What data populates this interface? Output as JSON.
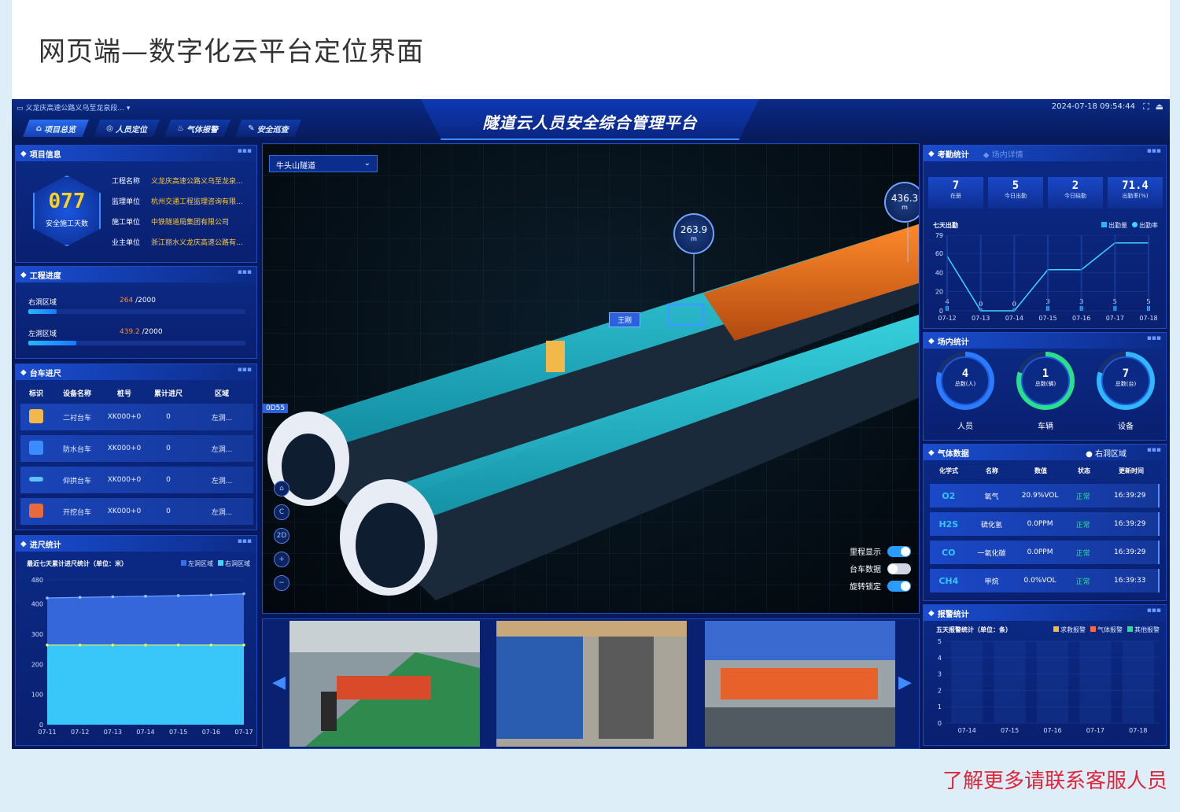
{
  "doc_title": "网页端—数字化云平台定位界面",
  "footer_note": "了解更多请联系客服人员",
  "header": {
    "project_select": "义龙庆高速公路义乌至龙泉段... ▾",
    "platform_title": "隧道云人员安全综合管理平台",
    "datetime": "2024-07-18 09:54:44",
    "nav": [
      {
        "label": "项目总览",
        "icon": "⌂"
      },
      {
        "label": "人员定位",
        "icon": "◎"
      },
      {
        "label": "气体报警",
        "icon": "♨"
      },
      {
        "label": "安全巡查",
        "icon": "✎"
      }
    ]
  },
  "project_info": {
    "title": "项目信息",
    "safe_days": "077",
    "safe_days_label": "安全施工天数",
    "rows": [
      {
        "k": "工程名称",
        "v": "义龙庆高速公路义乌至龙泉..."
      },
      {
        "k": "监理单位",
        "v": "杭州交通工程监理咨询有限..."
      },
      {
        "k": "施工单位",
        "v": "中铁隧道局集团有限公司"
      },
      {
        "k": "业主单位",
        "v": "浙江丽水义龙庆高速公路有..."
      }
    ]
  },
  "progress": {
    "title": "工程进度",
    "items": [
      {
        "label": "右洞区域",
        "value": "264",
        "total": "/2000",
        "fraction": 0.132
      },
      {
        "label": "左洞区域",
        "value": "439.2",
        "total": "/2000",
        "fraction": 0.22
      }
    ]
  },
  "carts": {
    "title": "台车进尺",
    "headers": [
      "标识",
      "设备名称",
      "桩号",
      "累计进尺",
      "区域"
    ],
    "rows": [
      {
        "name": "二衬台车",
        "station": "XK000+0",
        "total": "0",
        "area": "左洞...",
        "color": "#f2b84a"
      },
      {
        "name": "防水台车",
        "station": "XK000+0",
        "total": "0",
        "area": "左洞...",
        "color": "#3b8cff"
      },
      {
        "name": "仰拱台车",
        "station": "XK000+0",
        "total": "0",
        "area": "左洞...",
        "color": "#5fc0ff"
      },
      {
        "name": "开挖台车",
        "station": "XK000+0",
        "total": "0",
        "area": "左洞...",
        "color": "#e86a3a"
      }
    ]
  },
  "advance": {
    "title": "进尺统计",
    "subtitle": "最近七天累计进尺统计（单位：米）",
    "legend": [
      "左洞区域",
      "右洞区域"
    ]
  },
  "scene": {
    "tunnel_name": "牛头山隧道",
    "bubble1": {
      "value": "263.9",
      "unit": "m"
    },
    "bubble2": {
      "value": "436.3",
      "unit": "m"
    },
    "person_tag": "王刚",
    "left_tag": "0D55",
    "controls": [
      "⌂",
      "C",
      "2D",
      "+",
      "−"
    ],
    "toggles": [
      {
        "label": "里程显示",
        "on": true
      },
      {
        "label": "台车数据",
        "on": false
      },
      {
        "label": "旋转锁定",
        "on": true
      }
    ]
  },
  "attendance": {
    "title": "考勤统计",
    "tab2": "场内详情",
    "stats": [
      {
        "n": "7",
        "l": "在册"
      },
      {
        "n": "5",
        "l": "今日出勤"
      },
      {
        "n": "2",
        "l": "今日缺勤"
      },
      {
        "n": "71.4",
        "l": "出勤率(%)"
      }
    ],
    "chart_label": "七天出勤",
    "legend": [
      "出勤量",
      "出勤率"
    ]
  },
  "site_stats": {
    "title": "场内统计",
    "rings": [
      {
        "n": "4",
        "l": "总数(人)",
        "cap": "人员",
        "color": "#2a7bff"
      },
      {
        "n": "1",
        "l": "总数(辆)",
        "cap": "车辆",
        "color": "#28e08c"
      },
      {
        "n": "7",
        "l": "总数(台)",
        "cap": "设备",
        "color": "#30b8ff"
      }
    ]
  },
  "gas": {
    "title": "气体数据",
    "area": "● 右洞区域",
    "headers": [
      "化学式",
      "名称",
      "数值",
      "状态",
      "更新时间"
    ],
    "rows": [
      {
        "f": "O2",
        "name": "氧气",
        "val": "20.9%VOL",
        "st": "正常",
        "t": "16:39:29"
      },
      {
        "f": "H2S",
        "name": "硫化氢",
        "val": "0.0PPM",
        "st": "正常",
        "t": "16:39:29"
      },
      {
        "f": "CO",
        "name": "一氧化碳",
        "val": "0.0PPM",
        "st": "正常",
        "t": "16:39:29"
      },
      {
        "f": "CH4",
        "name": "甲烷",
        "val": "0.0%VOL",
        "st": "正常",
        "t": "16:39:33"
      }
    ]
  },
  "alarm": {
    "title": "报警统计",
    "subtitle": "五天报警统计（单位：条）",
    "legend": [
      "求救报警",
      "气体报警",
      "其他报警"
    ]
  },
  "chart_data": [
    {
      "type": "area",
      "title": "最近七天累计进尺统计（单位：米）",
      "categories": [
        "07-11",
        "07-12",
        "07-13",
        "07-14",
        "07-15",
        "07-16",
        "07-17"
      ],
      "series": [
        {
          "name": "左洞区域",
          "values": [
            420,
            422,
            424,
            426,
            428,
            430,
            434
          ]
        },
        {
          "name": "右洞区域",
          "values": [
            264,
            264,
            264,
            264,
            264,
            264,
            264
          ]
        }
      ],
      "ylim": [
        0,
        480
      ],
      "yticks": [
        0,
        100,
        200,
        300,
        400,
        480
      ],
      "colors": [
        "#3a6fe6",
        "#3ad8ff"
      ]
    },
    {
      "type": "line",
      "title": "七天出勤",
      "categories": [
        "07-12",
        "07-13",
        "07-14",
        "07-15",
        "07-16",
        "07-17",
        "07-18"
      ],
      "series": [
        {
          "name": "出勤量",
          "values": [
            4,
            0,
            0,
            3,
            3,
            5,
            5
          ]
        },
        {
          "name": "出勤率",
          "values": [
            57,
            0,
            0,
            43,
            43,
            71,
            71
          ]
        }
      ],
      "ylim": [
        0,
        79
      ],
      "yticks": [
        0,
        20,
        40,
        60,
        79
      ],
      "point_labels": [
        "4",
        "0",
        "0",
        "3",
        "3",
        "5",
        "5"
      ]
    },
    {
      "type": "bar",
      "title": "五天报警统计（单位：条）",
      "categories": [
        "07-14",
        "07-15",
        "07-16",
        "07-17",
        "07-18"
      ],
      "series": [
        {
          "name": "求救报警",
          "values": [
            0,
            0,
            0,
            0,
            0
          ]
        },
        {
          "name": "气体报警",
          "values": [
            0,
            0,
            0,
            0,
            0
          ]
        },
        {
          "name": "其他报警",
          "values": [
            0,
            0,
            0,
            0,
            0
          ]
        }
      ],
      "ylim": [
        0,
        5
      ],
      "yticks": [
        0,
        1,
        2,
        3,
        4,
        5
      ]
    }
  ]
}
